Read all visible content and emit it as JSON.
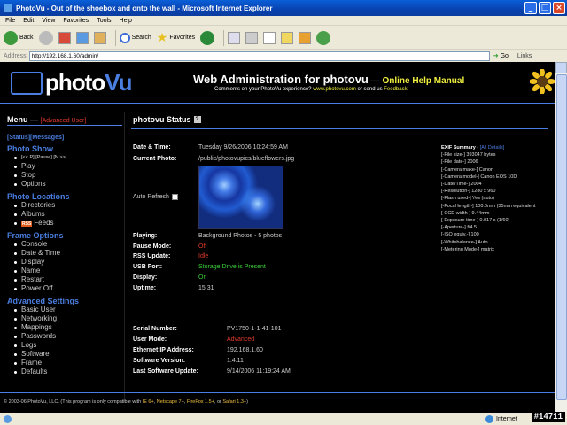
{
  "window": {
    "title": "PhotoVu - Out of the shoebox and onto the wall - Microsoft Internet Explorer"
  },
  "menubar": [
    "File",
    "Edit",
    "View",
    "Favorites",
    "Tools",
    "Help"
  ],
  "toolbar": {
    "back": "Back",
    "search": "Search",
    "favorites": "Favorites"
  },
  "address": {
    "label": "Address",
    "url": "http://192.168.1.60/admin/",
    "go": "Go",
    "links": "Links"
  },
  "header": {
    "logo_main": "photo",
    "logo_accent": "Vu",
    "title": "Web Administration for photovu",
    "dash": " — ",
    "help": "Online Help Manual",
    "sub_pre": "Comments on your PhotoVu experience? ",
    "sub_link1": "www.photovu.com",
    "sub_mid": " or send us ",
    "sub_link2": "Feedback!"
  },
  "menu": {
    "title": "Menu",
    "dash": " — ",
    "mode": "[Advanced User]",
    "tabs": "[Status][Messages]",
    "sections": [
      {
        "title": "Photo Show",
        "items": [
          "[<< P] [Pause] [N >>]",
          "Play",
          "Stop",
          "Options"
        ]
      },
      {
        "title": "Photo Locations",
        "items": [
          "Directories",
          "Albums",
          "Feeds"
        ]
      },
      {
        "title": "Frame Options",
        "items": [
          "Console",
          "Date & Time",
          "Display",
          "Name",
          "Restart",
          "Power Off"
        ]
      },
      {
        "title": "Advanced Settings",
        "items": [
          "Basic User",
          "Networking",
          "Mappings",
          "Passwords",
          "Logs",
          "Software",
          "Frame",
          "Defaults"
        ]
      }
    ],
    "rss_badge": "RSS"
  },
  "status": {
    "title": "photovu Status",
    "help_icon": "?",
    "date_label": "Date & Time:",
    "date_value": "Tuesday 9/26/2006 10:24:59 AM",
    "photo_label": "Current Photo:",
    "photo_value": "/public/photovupics/blueflowers.jpg",
    "auto_refresh": "Auto Refresh",
    "playing_label": "Playing:",
    "playing_value": "Background Photos - 5 photos",
    "pause_label": "Pause Mode:",
    "pause_value": "Off",
    "rss_label": "RSS Update:",
    "rss_value": "Idle",
    "usb_label": "USB Port:",
    "usb_value": "Storage Drive is Present",
    "display_label": "Display:",
    "display_value": "On",
    "uptime_label": "Uptime:",
    "uptime_value": "15:31",
    "serial_label": "Serial Number:",
    "serial_value": "PV1750-1-1-41-101",
    "usermode_label": "User Mode:",
    "usermode_value": "Advanced",
    "ip_label": "Ethernet IP Address:",
    "ip_value": "192.168.1.60",
    "sw_label": "Software Version:",
    "sw_value": "1.4.11",
    "swu_label": "Last Software Update:",
    "swu_value": "9/14/2006 11:19:24 AM"
  },
  "exif": {
    "title": "EXIF Summary - ",
    "all": "[All Details]",
    "lines": [
      "[-File size-] 393047 bytes",
      "[-File date-] 2006",
      "[-Camera make-] Canon",
      "[-Camera model-] Canon EOS 10D",
      "[-Date/Time-] 2004",
      "[-Resolution-] 1280 x 960",
      "[-Flash used-] Yes (auto)",
      "[-Focal length-] 100.0mm (35mm equivalent",
      "[-CCD width-] 9.44mm",
      "[-Exposure time-] 0.017 s (1/60)",
      "[-Aperture-] f/4.5",
      "[-ISO equiv.-] 100",
      "[-Whitebalance-] Auto",
      "[-Metering Mode-] matrix"
    ]
  },
  "footer": {
    "pre": "© 2003-06 PhotoVu, LLC.  (This program is only compatible with ",
    "b1": "IE 6+",
    "s1": ", ",
    "b2": "Netscape 7+",
    "s2": ", ",
    "b3": "FireFox 1.5+",
    "s3": ", or ",
    "b4": "Safari 1.3+",
    "post": ")"
  },
  "statusbar": {
    "zone": "Internet"
  },
  "watermark": "#14711",
  "colors": {
    "accent_blue": "#4a7ee0",
    "alert_red": "#e03a2a",
    "ok_green": "#3ad03a",
    "help_yellow": "#f0f040"
  }
}
